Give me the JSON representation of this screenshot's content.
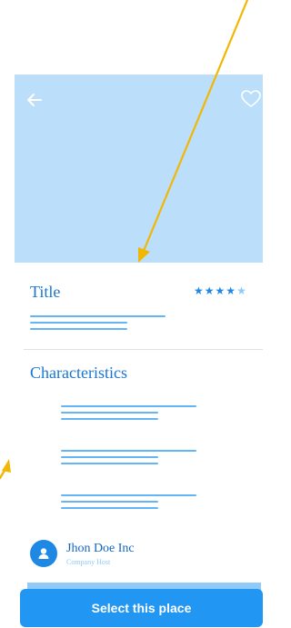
{
  "header": {
    "back_icon": "arrow-left-icon",
    "favorite_icon": "heart-outline-icon"
  },
  "place": {
    "title": "Title",
    "rating": 4,
    "rating_max": 5
  },
  "characteristics": {
    "heading": "Characteristics"
  },
  "host": {
    "name": "Jhon Doe Inc",
    "role": "Company Host",
    "avatar_icon": "person-icon"
  },
  "cta": {
    "label": "Select this place"
  },
  "colors": {
    "primary": "#2196F3",
    "hero_placeholder": "#BBDEFB",
    "annotation_arrow": "#F2B705"
  }
}
